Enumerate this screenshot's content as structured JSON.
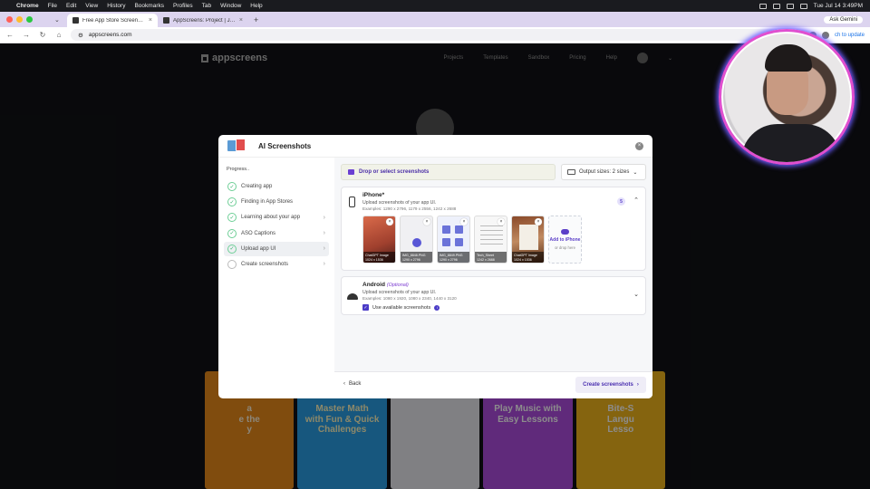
{
  "menubar": {
    "app": "Chrome",
    "items": [
      "File",
      "Edit",
      "View",
      "History",
      "Bookmarks",
      "Profiles",
      "Tab",
      "Window",
      "Help"
    ],
    "datetime": "Tue Jul 14  3:49PM"
  },
  "browser": {
    "tabs": [
      {
        "title": "Free App Store Screenshot G",
        "active": true
      },
      {
        "title": "AppScreens: Project | JPG to",
        "active": false
      }
    ],
    "gemini_label": "Ask Gemini",
    "url": "appscreens.com",
    "update_label": "ch to update"
  },
  "site": {
    "logo": "appscreens",
    "nav": [
      "Projects",
      "Templates",
      "Sandbox",
      "Pricing",
      "Help"
    ],
    "avatar_initial": "JL"
  },
  "bg_cards": [
    {
      "text": "a\ne the\ny",
      "theme": "orange"
    },
    {
      "text": "Master Math\nwith Fun & Quick\nChallenges",
      "theme": "blue"
    },
    {
      "text": "",
      "theme": "panel"
    },
    {
      "text": "Play Music with\nEasy Lessons",
      "theme": "purple"
    },
    {
      "text": "Bite-S\nLangu\nLesso",
      "theme": "yellow"
    }
  ],
  "modal": {
    "title": "AI Screenshots",
    "progress_label": "Progress..",
    "steps": [
      {
        "label": "Creating app",
        "done": true,
        "chevron": false,
        "active": false
      },
      {
        "label": "Finding in App Stores",
        "done": true,
        "chevron": false,
        "active": false
      },
      {
        "label": "Learning about your app",
        "done": true,
        "chevron": true,
        "active": false
      },
      {
        "label": "ASO Captions",
        "done": true,
        "chevron": true,
        "active": false
      },
      {
        "label": "Upload app UI",
        "done": true,
        "chevron": true,
        "active": true
      },
      {
        "label": "Create screenshots",
        "done": false,
        "chevron": true,
        "active": false
      }
    ],
    "drop_label": "Drop or select screenshots",
    "output_sizes_label": "Output sizes: 2 sizes",
    "iphone": {
      "name": "iPhone*",
      "desc": "Upload screenshots of your app UI.",
      "examples": "Examples: 1290 x 2796, 1179 x 2556, 1242 x 2688",
      "count": "5",
      "thumbnails": [
        {
          "caption": "ChatGPT Image\n1024 x 1536",
          "style": "t1"
        },
        {
          "caption": "IMG_8848.PNG\n1290 x 2796",
          "style": "t2"
        },
        {
          "caption": "IMG_8849.PNG\n1290 x 2796",
          "style": "t3"
        },
        {
          "caption": "Tech_Sheet\n1242 x 2688",
          "style": "t4"
        },
        {
          "caption": "ChatGPT Image\n1024 x 1536",
          "style": "t5"
        }
      ],
      "add_label": "Add to iPhone",
      "drop_here": "or drop here"
    },
    "android": {
      "name": "Android",
      "optional": "(Optional)",
      "desc": "Upload screenshots of your app UI.",
      "examples": "Examples: 1080 x 1920, 1080 x 2340, 1440 x 3120",
      "use_available": "Use available screenshots"
    },
    "back_label": "Back",
    "create_label": "Create screenshots"
  }
}
